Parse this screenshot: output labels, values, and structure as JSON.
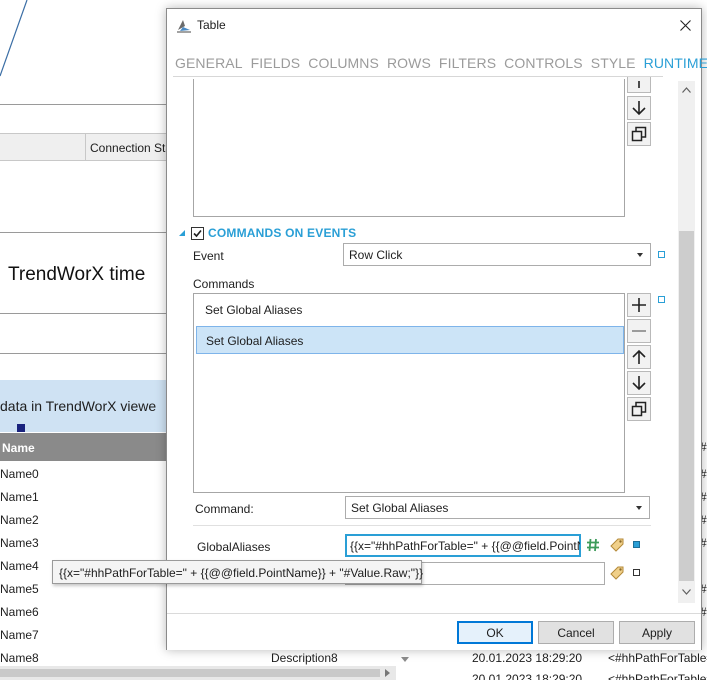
{
  "background": {
    "connection_header": "Connection Sta",
    "trend_title": "TrendWorX time",
    "band_text": "data in TrendWorX viewe",
    "name_header": "Name",
    "names": [
      "Name0",
      "Name1",
      "Name2",
      "Name3",
      "Name4",
      "Name5",
      "Name6",
      "Name7",
      "Name8"
    ],
    "description": "Description8",
    "dates": [
      "20.01.2023 18:29:20",
      "20.01.2023 18:29:20"
    ],
    "expressions": [
      "<#hhPathForTable#",
      "<#hhPathForTable#"
    ],
    "hash_col": [
      "#",
      "#",
      "#",
      "#",
      "#",
      "#",
      "#"
    ]
  },
  "dialog": {
    "title": "Table",
    "tabs": [
      "GENERAL",
      "FIELDS",
      "COLUMNS",
      "ROWS",
      "FILTERS",
      "CONTROLS",
      "STYLE",
      "RUNTIME"
    ],
    "active_tab": "RUNTIME",
    "section": {
      "label": "COMMANDS ON EVENTS",
      "checked": true
    },
    "event": {
      "label": "Event",
      "value": "Row Click"
    },
    "commands": {
      "label": "Commands",
      "items": [
        "Set Global Aliases",
        "Set Global Aliases"
      ],
      "selected_index": 1
    },
    "command": {
      "label": "Command:",
      "value": "Set Global Aliases"
    },
    "global_aliases": {
      "label": "GlobalAliases",
      "value": "{{x=\"#hhPathForTable=\" + {{@@field.PointN"
    },
    "tooltip": "{{x=\"#hhPathForTable=\" + {{@@field.PointName}} + \"#Value.Raw;\"}}",
    "buttons": {
      "ok": "OK",
      "cancel": "Cancel",
      "apply": "Apply"
    }
  },
  "colors": {
    "accent": "#2a9fd6",
    "selection": "#cce4f7",
    "tab_inactive": "#9b9b9b"
  }
}
